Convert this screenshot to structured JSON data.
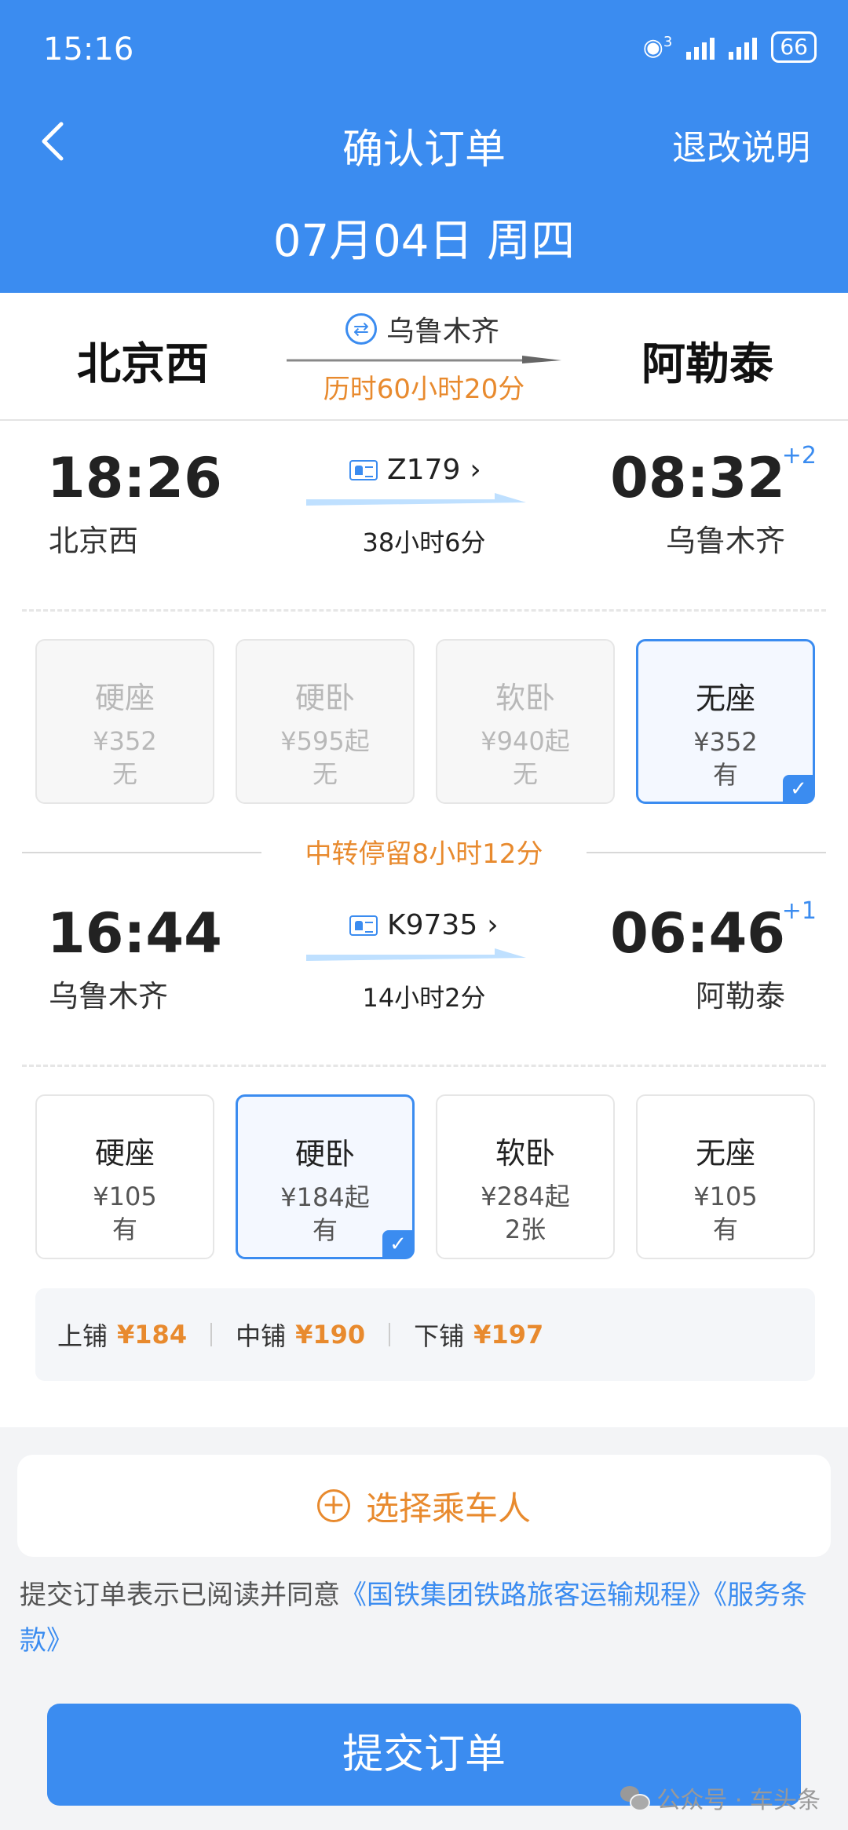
{
  "status": {
    "time": "15:16",
    "battery": "66",
    "network_badge": "3"
  },
  "header": {
    "title": "确认订单",
    "refund_link": "退改说明",
    "date": "07月04日 周四"
  },
  "route": {
    "from": "北京西",
    "to": "阿勒泰",
    "via": "乌鲁木齐",
    "duration": "历时60小时20分"
  },
  "segments": [
    {
      "dep_time": "18:26",
      "dep_station": "北京西",
      "arr_time": "08:32",
      "arr_station": "乌鲁木齐",
      "day_plus": "+2",
      "train_no": "Z179",
      "duration": "38小时6分",
      "seats": [
        {
          "name": "硬座",
          "price": "¥352",
          "avail": "无"
        },
        {
          "name": "硬卧",
          "price": "¥595起",
          "avail": "无"
        },
        {
          "name": "软卧",
          "price": "¥940起",
          "avail": "无"
        },
        {
          "name": "无座",
          "price": "¥352",
          "avail": "有"
        }
      ]
    },
    {
      "dep_time": "16:44",
      "dep_station": "乌鲁木齐",
      "arr_time": "06:46",
      "arr_station": "阿勒泰",
      "day_plus": "+1",
      "train_no": "K9735",
      "duration": "14小时2分",
      "seats": [
        {
          "name": "硬座",
          "price": "¥105",
          "avail": "有"
        },
        {
          "name": "硬卧",
          "price": "¥184起",
          "avail": "有"
        },
        {
          "name": "软卧",
          "price": "¥284起",
          "avail": "2张"
        },
        {
          "name": "无座",
          "price": "¥105",
          "avail": "有"
        }
      ]
    }
  ],
  "transfer": "中转停留8小时12分",
  "berths": [
    {
      "label": "上铺",
      "price": "¥184"
    },
    {
      "label": "中铺",
      "price": "¥190"
    },
    {
      "label": "下铺",
      "price": "¥197"
    }
  ],
  "passenger_button": "选择乘车人",
  "agreement": {
    "text": "提交订单表示已阅读并同意",
    "link1": "《国铁集团铁路旅客运输规程》",
    "link2": "《服务条款》"
  },
  "submit": "提交订单",
  "watermark": "公众号 · 车头条",
  "colors": {
    "primary": "#3b8cf0",
    "accent": "#e88a2e"
  }
}
